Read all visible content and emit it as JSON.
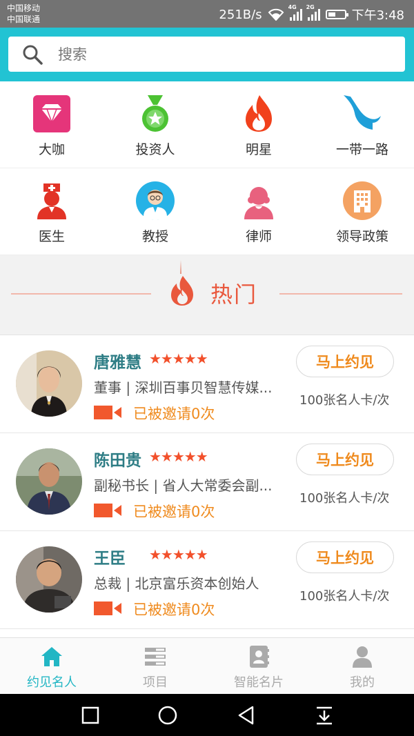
{
  "status_bar": {
    "carrier_1": "中国移动",
    "carrier_2": "中国联通",
    "speed": "251B/s",
    "net_1": "4G",
    "net_2": "2G",
    "time": "下午3:48"
  },
  "search": {
    "placeholder": "搜索",
    "icon": "search-icon"
  },
  "categories": [
    {
      "label": "大咖",
      "icon": "diamond-icon",
      "color": "#e5357a"
    },
    {
      "label": "投资人",
      "icon": "medal-icon",
      "color": "#4cc233"
    },
    {
      "label": "明星",
      "icon": "flame-icon",
      "color": "#f1411c"
    },
    {
      "label": "一带一路",
      "icon": "route-icon",
      "color": "#1f9fd8"
    },
    {
      "label": "医生",
      "icon": "doctor-icon",
      "color": "#e23326"
    },
    {
      "label": "教授",
      "icon": "professor-icon",
      "color": "#26b2e6"
    },
    {
      "label": "律师",
      "icon": "lawyer-icon",
      "color": "#e8617e"
    },
    {
      "label": "领导政策",
      "icon": "building-icon",
      "color": "#f4a262"
    }
  ],
  "hot": {
    "title": "热门",
    "icon": "flame-icon"
  },
  "people": [
    {
      "name": "唐雅慧",
      "stars": "★★★★★",
      "title": "董事 | 深圳百事贝智慧传媒...",
      "invited": "已被邀请0次",
      "button": "马上约见",
      "price": "100张名人卡/次"
    },
    {
      "name": "陈田贵",
      "stars": "★★★★★",
      "title": "副秘书长 | 省人大常委会副...",
      "invited": "已被邀请0次",
      "button": "马上约见",
      "price": "100张名人卡/次"
    },
    {
      "name": "王臣",
      "stars": "★★★★★",
      "title": "总裁 | 北京富乐资本创始人",
      "invited": "已被邀请0次",
      "button": "马上约见",
      "price": "100张名人卡/次"
    }
  ],
  "tabs": [
    {
      "label": "约见名人",
      "icon": "home-icon",
      "active": true
    },
    {
      "label": "项目",
      "icon": "list-icon",
      "active": false
    },
    {
      "label": "智能名片",
      "icon": "contact-card-icon",
      "active": false
    },
    {
      "label": "我的",
      "icon": "user-icon",
      "active": false
    }
  ],
  "colors": {
    "accent": "#22c3d3",
    "hot_red": "#e9583d",
    "orange": "#ef8a1d",
    "name_teal": "#2e7d85"
  }
}
